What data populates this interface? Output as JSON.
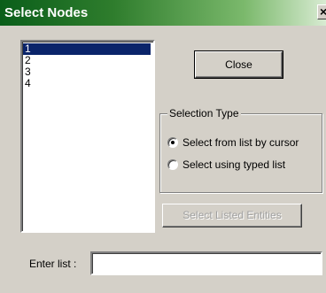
{
  "window": {
    "title": "Select Nodes",
    "close_glyph": "×"
  },
  "node_list": {
    "items": [
      "1",
      "2",
      "3",
      "4"
    ],
    "selected_index": 0
  },
  "buttons": {
    "close_label": "Close",
    "select_listed_label": "Select Listed Entities"
  },
  "selection_type": {
    "legend": "Selection Type",
    "options": [
      {
        "label": "Select from list by cursor",
        "checked": true
      },
      {
        "label": "Select using typed list",
        "checked": false
      }
    ]
  },
  "enter_list": {
    "label": "Enter list :",
    "value": ""
  },
  "colors": {
    "title_gradient_start": "#0a5e1a",
    "title_gradient_end": "#d8ebd2",
    "selection_highlight": "#0a246a",
    "dialog_face": "#d4d0c8"
  }
}
